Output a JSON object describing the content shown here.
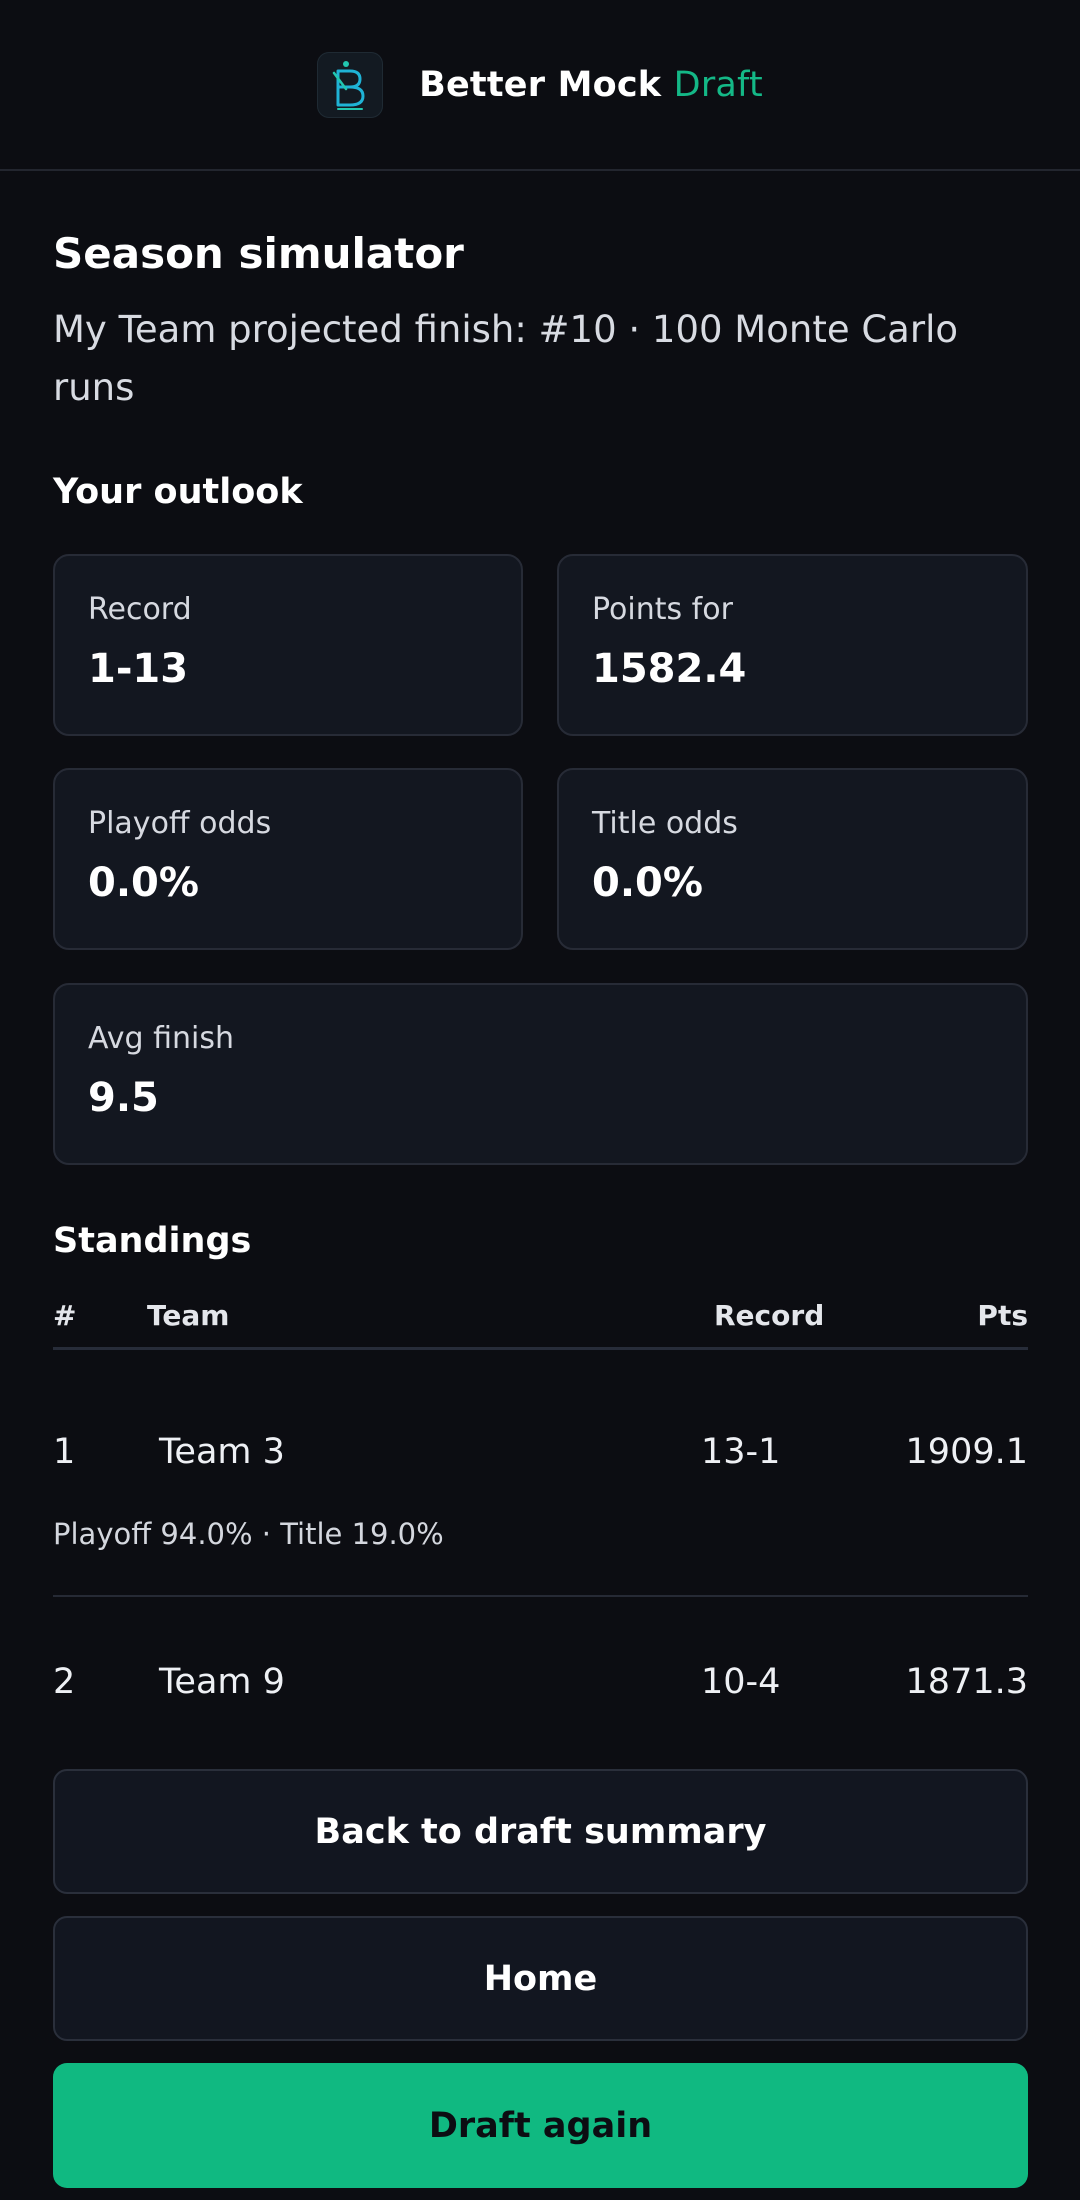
{
  "header": {
    "brand_primary": "Better Mock",
    "brand_accent": "Draft",
    "logo_icon": "b-monogram-logo",
    "accent_color": "#14b887"
  },
  "page": {
    "title": "Season simulator",
    "subtitle": "My Team projected finish: #10 · 100 Monte Carlo runs"
  },
  "outlook": {
    "title": "Your outlook",
    "cards": [
      {
        "label": "Record",
        "value": "1-13"
      },
      {
        "label": "Points for",
        "value": "1582.4"
      },
      {
        "label": "Playoff odds",
        "value": "0.0%"
      },
      {
        "label": "Title odds",
        "value": "0.0%"
      },
      {
        "label": "Avg finish",
        "value": "9.5"
      }
    ]
  },
  "standings": {
    "title": "Standings",
    "columns": {
      "rank": "#",
      "team": "Team",
      "record": "Record",
      "pts": "Pts"
    },
    "rows": [
      {
        "rank": "1",
        "team": "Team 3",
        "record": "13-1",
        "pts": "1909.1",
        "note": "Playoff 94.0% · Title 19.0%"
      },
      {
        "rank": "2",
        "team": "Team 9",
        "record": "10-4",
        "pts": "1871.3"
      }
    ]
  },
  "actions": {
    "back_label": "Back to draft summary",
    "home_label": "Home",
    "draft_again_label": "Draft again",
    "primary_color": "#10b981"
  }
}
